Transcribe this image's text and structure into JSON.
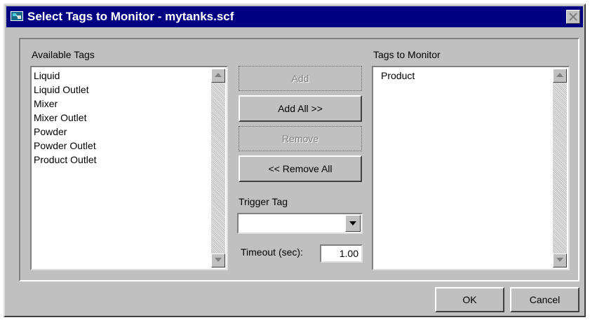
{
  "window": {
    "title": "Select Tags to Monitor - mytanks.scf",
    "icon": "app-icon",
    "close_icon": "close-icon"
  },
  "available": {
    "label": "Available Tags",
    "items": [
      "Liquid",
      "Liquid Outlet",
      "Mixer",
      "Mixer Outlet",
      "Powder",
      "Powder Outlet",
      "Product Outlet"
    ]
  },
  "monitor": {
    "label": "Tags to Monitor",
    "items": [
      "Product"
    ]
  },
  "buttons": {
    "add": "Add",
    "add_all": "Add All >>",
    "remove": "Remove",
    "remove_all": "<< Remove All",
    "ok": "OK",
    "cancel": "Cancel"
  },
  "trigger": {
    "label": "Trigger Tag",
    "value": ""
  },
  "timeout": {
    "label": "Timeout (sec):",
    "value": "1.00"
  },
  "colors": {
    "titlebar": "#000080",
    "face": "#c0c0c0"
  }
}
